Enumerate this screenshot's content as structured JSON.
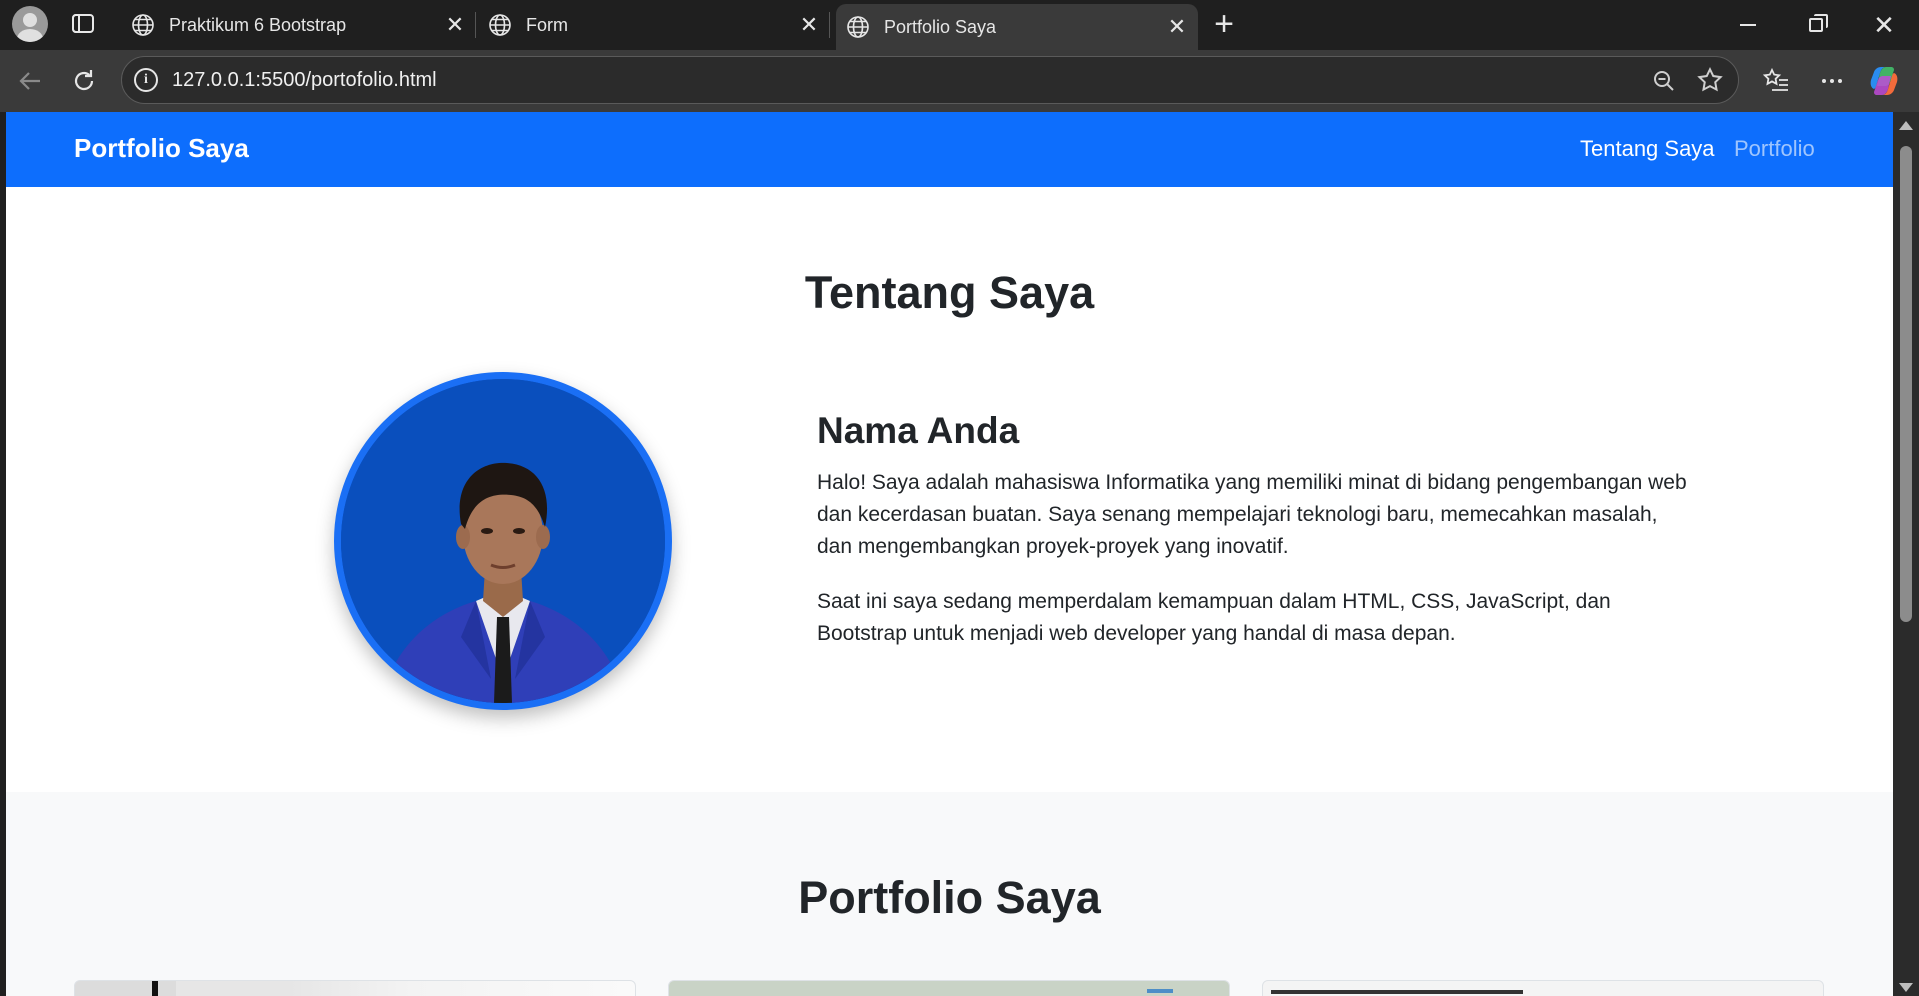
{
  "browser": {
    "tabs": [
      {
        "title": "Praktikum 6 Bootstrap",
        "active": false
      },
      {
        "title": "Form",
        "active": false
      },
      {
        "title": "Portfolio Saya",
        "active": true
      }
    ],
    "close_glyph": "✕",
    "new_tab_glyph": "+",
    "url": "127.0.0.1:5500/portofolio.html",
    "accent_color": "#3a3a3a"
  },
  "page": {
    "navbar": {
      "brand": "Portfolio Saya",
      "links": [
        {
          "label": "Tentang Saya",
          "active": true
        },
        {
          "label": "Portfolio",
          "active": false
        }
      ],
      "color": "#0d6efd"
    },
    "about": {
      "heading": "Tentang Saya",
      "name": "Nama Anda",
      "paragraphs": [
        "Halo! Saya adalah mahasiswa Informatika yang memiliki minat di bidang pengembangan web dan kecerdasan buatan. Saya senang mempelajari teknologi baru, memecahkan masalah, dan mengembangkan proyek-proyek yang inovatif.",
        "Saat ini saya sedang memperdalam kemampuan dalam HTML, CSS, JavaScript, dan Bootstrap untuk menjadi web developer yang handal di masa depan."
      ],
      "photo_icon": "profile-photo"
    },
    "portfolio": {
      "heading": "Portfolio Saya",
      "cards": 3
    }
  }
}
